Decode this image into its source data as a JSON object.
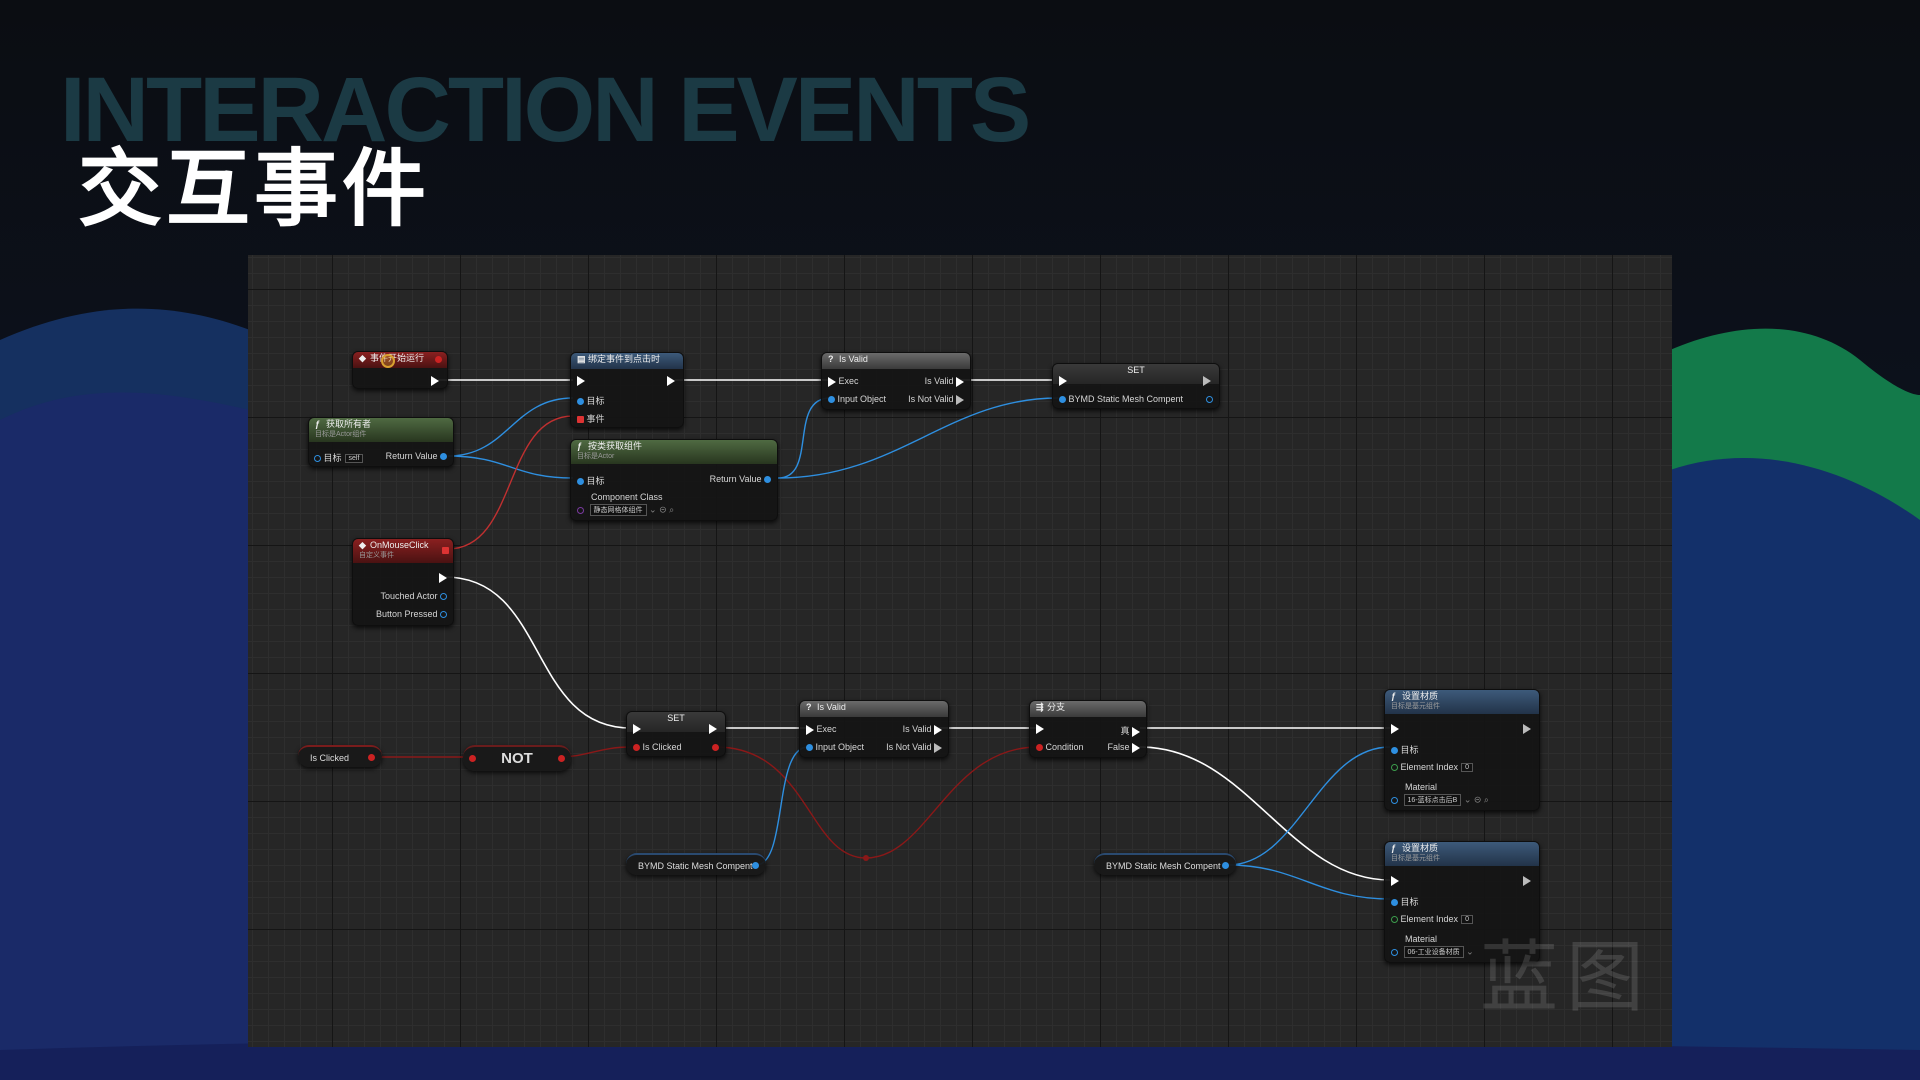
{
  "slide": {
    "bg_title": "INTERACTION EVENTS",
    "title": "交互事件"
  },
  "graph": {
    "watermark": "蓝图",
    "nodes": {
      "begin_play": {
        "title": "事件开始运行"
      },
      "get_owner": {
        "title": "获取所有者",
        "subtitle": "目标是Actor组件",
        "target_label": "目标",
        "target_value": "self",
        "return_label": "Return Value"
      },
      "bind_event": {
        "title": "绑定事件到点击时",
        "target_label": "目标",
        "event_label": "事件"
      },
      "get_component": {
        "title": "按类获取组件",
        "subtitle": "目标是Actor",
        "target_label": "目标",
        "return_label": "Return Value",
        "class_label": "Component Class",
        "class_value": "静态网格体组件"
      },
      "is_valid_top": {
        "title": "Is Valid",
        "exec_label": "Exec",
        "input_label": "Input Object",
        "valid_label": "Is Valid",
        "not_valid_label": "Is Not Valid"
      },
      "set_top": {
        "title": "SET",
        "var_label": "BYMD Static Mesh Compent"
      },
      "on_mouse_click": {
        "title": "OnMouseClick",
        "subtitle": "自定义事件",
        "touched_label": "Touched Actor",
        "button_label": "Button Pressed"
      },
      "is_clicked_getter": {
        "label": "Is Clicked"
      },
      "not_node": {
        "label": "NOT"
      },
      "set_bottom": {
        "title": "SET",
        "var_label": "Is Clicked"
      },
      "is_valid_bottom": {
        "title": "Is Valid",
        "exec_label": "Exec",
        "input_label": "Input Object",
        "valid_label": "Is Valid",
        "not_valid_label": "Is Not Valid"
      },
      "branch": {
        "title": "分支",
        "true_label": "真",
        "condition_label": "Condition",
        "false_label": "False"
      },
      "mesh_getter_1": {
        "label": "BYMD Static Mesh Compent"
      },
      "mesh_getter_2": {
        "label": "BYMD Static Mesh Compent"
      },
      "set_material_1": {
        "title": "设置材质",
        "subtitle": "目标是基元组件",
        "target_label": "目标",
        "index_label": "Element Index",
        "index_value": "0",
        "material_label": "Material",
        "material_value": "16-蓝标点击后B"
      },
      "set_material_2": {
        "title": "设置材质",
        "subtitle": "目标是基元组件",
        "target_label": "目标",
        "index_label": "Element Index",
        "index_value": "0",
        "material_label": "Material",
        "material_value": "06-工业设备材质"
      }
    }
  },
  "colors": {
    "exec_wire": "#ffffff",
    "object_wire": "#2e8fe0",
    "bool_wire": "#8a1818",
    "delegate_wire": "#c03030"
  }
}
